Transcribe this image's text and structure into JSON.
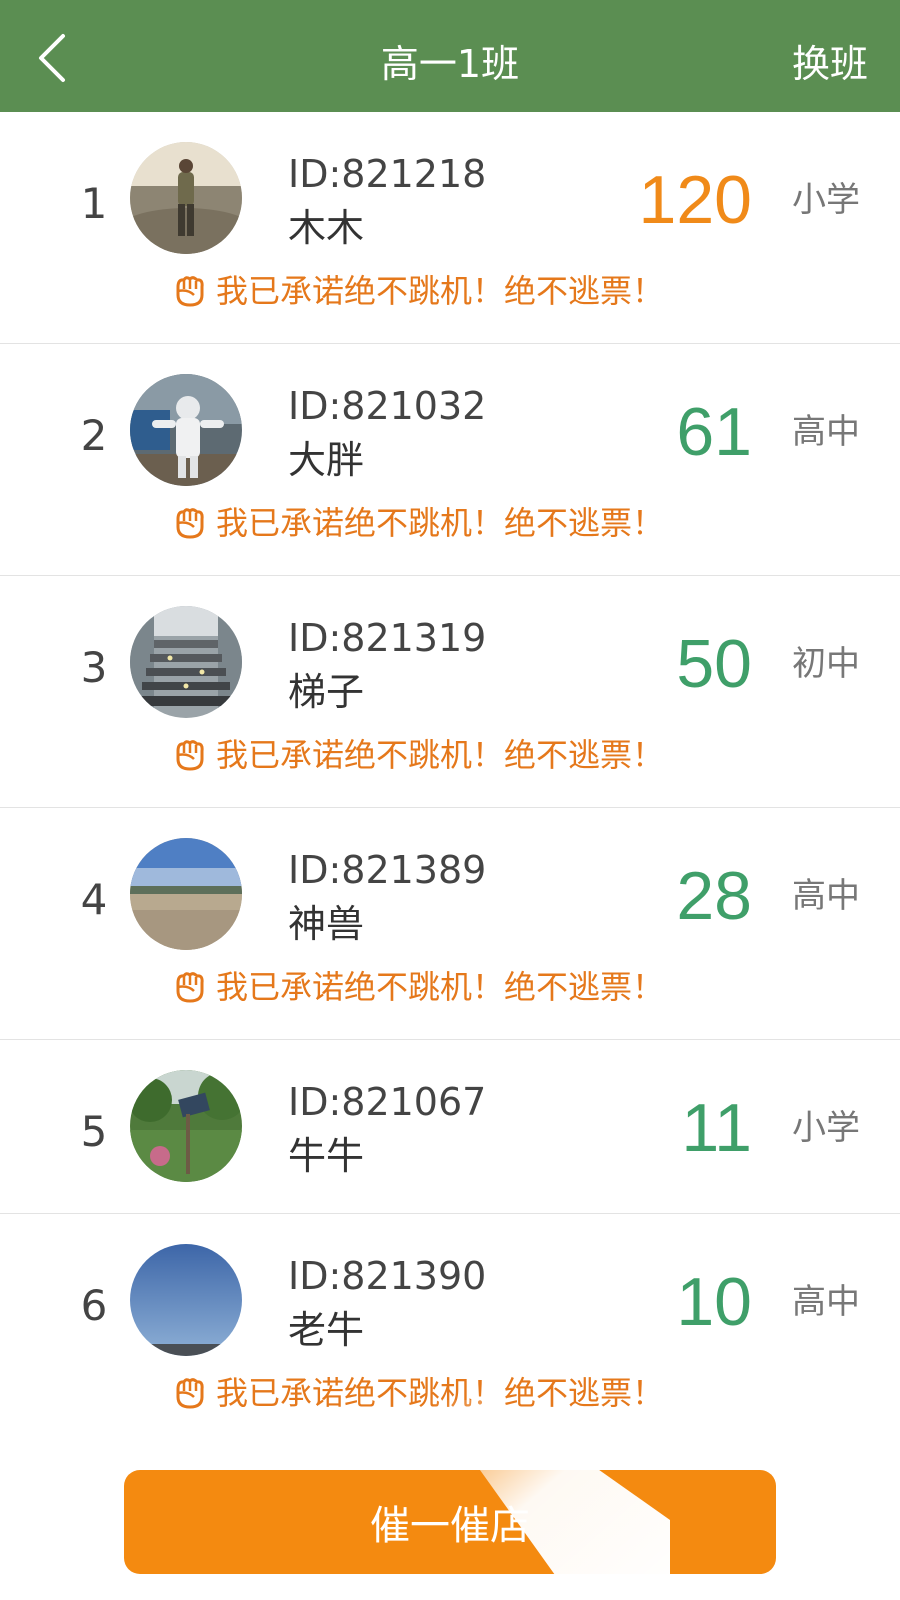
{
  "header": {
    "title": "高一1班",
    "switch_label": "换班",
    "background_color": "#5b8e52"
  },
  "colors": {
    "top_score": "#f08a19",
    "score": "#3f9f69",
    "pledge": "#e5781b",
    "button": "#f48a10"
  },
  "students": [
    {
      "rank": "1",
      "id": "ID:821218",
      "name": "木木",
      "score": "120",
      "level": "小学",
      "pledge": "我已承诺绝不跳机！绝不逃票！",
      "avatar_icon": "man-walking-on-beach-photo"
    },
    {
      "rank": "2",
      "id": "ID:821032",
      "name": "大胖",
      "score": "61",
      "level": "高中",
      "pledge": "我已承诺绝不跳机！绝不逃票！",
      "avatar_icon": "astronaut-statue-photo"
    },
    {
      "rank": "3",
      "id": "ID:821319",
      "name": "梯子",
      "score": "50",
      "level": "初中",
      "pledge": "我已承诺绝不跳机！绝不逃票！",
      "avatar_icon": "staircase-photo"
    },
    {
      "rank": "4",
      "id": "ID:821389",
      "name": "神兽",
      "score": "28",
      "level": "高中",
      "pledge": "我已承诺绝不跳机！绝不逃票！",
      "avatar_icon": "beach-landscape-photo"
    },
    {
      "rank": "5",
      "id": "ID:821067",
      "name": "牛牛",
      "score": "11",
      "level": "小学",
      "avatar_icon": "garden-solar-panel-photo"
    },
    {
      "rank": "6",
      "id": "ID:821390",
      "name": "老牛",
      "score": "10",
      "level": "高中",
      "pledge": "我已承诺绝不跳机！绝不逃票！",
      "avatar_icon": "blue-sky-photo"
    }
  ],
  "urge_button": {
    "label": "催一催店"
  }
}
